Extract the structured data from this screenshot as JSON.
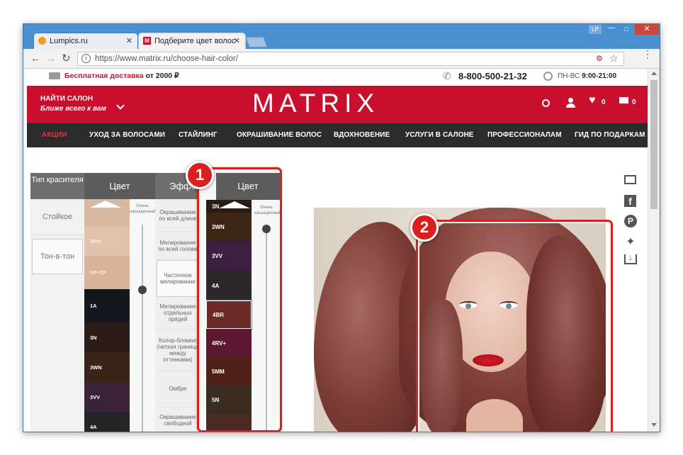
{
  "browser": {
    "tabs": [
      {
        "label": "Lumpics.ru"
      },
      {
        "label": "Подберите цвет волос"
      }
    ],
    "user_badge": "LP",
    "url": "https://www.matrix.ru/choose-hair-color/"
  },
  "topbar": {
    "delivery_label": "Бесплатная доставка",
    "delivery_amount": "от 2000",
    "currency": "₽",
    "phone": "8-800-500-21-32",
    "hours_days": "ПН-ВС",
    "hours_time": "9:00-21:00"
  },
  "header": {
    "find_salon": "НАЙТИ САЛОН",
    "find_salon_sub": "Ближе всего к вам",
    "logo": "MATRIX",
    "wishlist_count": "0",
    "cart_count": "0",
    "accent": "#c8102e"
  },
  "nav": [
    "АКЦИИ",
    "УХОД ЗА ВОЛОСАМИ",
    "СТАЙЛИНГ",
    "ОКРАШИВАНИЕ ВОЛОС",
    "ВДОХНОВЕНИЕ",
    "УСЛУГИ В САЛОНЕ",
    "ПРОФЕССИОНАЛАМ",
    "ГИД ПО ПОДАРКАМ"
  ],
  "picker": {
    "col_type": "Тип красителя",
    "col_color": "Цвет",
    "col_effect": "Эффект",
    "types": [
      "Стойкое",
      "Тон-в-тон"
    ],
    "intensity_label": "Очень насыщенный",
    "swatches": [
      {
        "code": "",
        "color": "#d9b8a2"
      },
      {
        "code": "SPN",
        "color": "#e0c2ad"
      },
      {
        "code": "SP-CP",
        "color": "#d8b39a"
      },
      {
        "code": "1A",
        "color": "#14171b"
      },
      {
        "code": "3N",
        "color": "#2b1c17"
      },
      {
        "code": "3WN",
        "color": "#3a2418"
      },
      {
        "code": "3VV",
        "color": "#3a2238"
      },
      {
        "code": "4A",
        "color": "#252525"
      },
      {
        "code": "",
        "color": "#5a2a1e"
      }
    ],
    "effects": [
      "Окрашивание по всей длине",
      "Мелирование по всей голове",
      "Частичное мелирование",
      "Мелирование отдельных прядей",
      "Колор-блокинг (четкая граница между оттенками)",
      "Омбре",
      "Окрашивание свободной"
    ]
  },
  "zoom_panel": {
    "title": "Цвет",
    "intensity_label": "Очень насыщенный",
    "swatches": [
      {
        "code": "3N",
        "color": "#2a1b16"
      },
      {
        "code": "3WN",
        "color": "#3d2516"
      },
      {
        "code": "3VV",
        "color": "#3b1f3e"
      },
      {
        "code": "4A",
        "color": "#2a2828"
      },
      {
        "code": "4BR",
        "color": "#6b2a26"
      },
      {
        "code": "4RV+",
        "color": "#5e1730"
      },
      {
        "code": "5MM",
        "color": "#4e2018"
      },
      {
        "code": "5N",
        "color": "#3b2c22"
      },
      {
        "code": "",
        "color": "#4a2a22"
      }
    ]
  },
  "annotations": {
    "marker_1": "1",
    "marker_2": "2",
    "marker_color": "#d8201f"
  },
  "share_icons": [
    "mail-icon",
    "facebook-icon",
    "pinterest-icon",
    "twitter-icon",
    "download-icon"
  ]
}
